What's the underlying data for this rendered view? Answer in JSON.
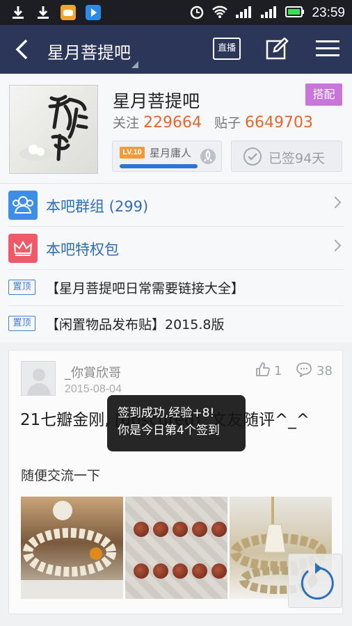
{
  "statusbar": {
    "time": "23:59"
  },
  "navbar": {
    "title": "星月菩提吧",
    "live_label": "直播"
  },
  "forum": {
    "name": "星月菩提吧",
    "match_tag": "搭配",
    "follow_label": "关注",
    "follow_count": "229664",
    "posts_label": "贴子",
    "posts_count": "6649703",
    "level_badge": "LV.10",
    "level_name": "星月庸人",
    "signed_label": "已签94天"
  },
  "rows": {
    "group_label": "本吧群组 (299)",
    "privilege_label": "本吧特权包",
    "pin_tag": "置顶",
    "pinned": [
      "【星月菩提吧日常需要链接大全】",
      "【闲置物品发布贴】2015.8版"
    ]
  },
  "post": {
    "author": "_你賞欣哥",
    "date": "2015-08-04",
    "likes": "1",
    "comments": "38",
    "title": "21七瓣金刚, [obscured], 文友随评^_^",
    "body": "随便交流一下"
  },
  "toast": {
    "line1": "签到成功,经验+8!",
    "line2": "你是今日第4个签到"
  },
  "colors": {
    "nav_bg": "#2b3658",
    "accent_orange": "#e5662e",
    "link_blue": "#2f6db5",
    "match_tag": "#c876d9"
  }
}
